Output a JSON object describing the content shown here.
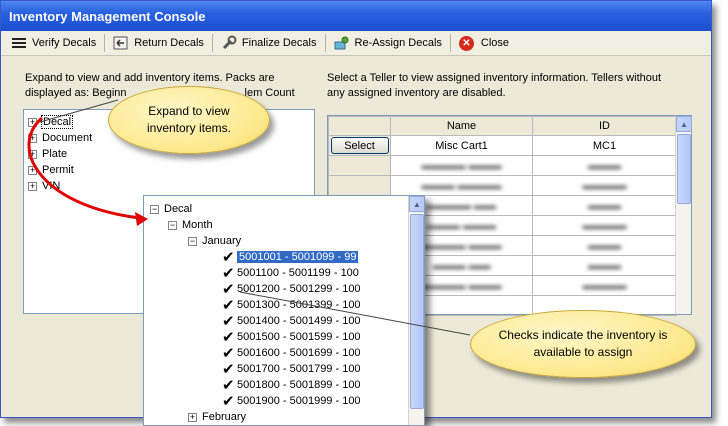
{
  "window": {
    "title": "Inventory Management Console"
  },
  "toolbar": {
    "verify_label": "Verify Decals",
    "return_label": "Return Decals",
    "finalize_label": "Finalize Decals",
    "reassign_label": "Re-Assign Decals",
    "close_label": "Close"
  },
  "left_panel": {
    "description_line1": "Expand to view and add inventory items.  Packs are",
    "description_line2_start": "displayed as:  Beginn",
    "description_line2_end": "lem Count",
    "tree": [
      {
        "label": "Decal"
      },
      {
        "label": "Document"
      },
      {
        "label": "Plate"
      },
      {
        "label": "Permit"
      },
      {
        "label": "VIN"
      }
    ]
  },
  "right_panel": {
    "description_line1": "Select a Teller to view assigned inventory information.  Tellers without",
    "description_line2": "any assigned inventory are disabled.",
    "columns": [
      "Name",
      "ID"
    ],
    "rows": [
      {
        "action": "Select",
        "name": "Misc Cart1",
        "id": "MC1"
      }
    ]
  },
  "zoom_tree": {
    "root": "Decal",
    "group": "Month",
    "month_open": "January",
    "ranges": [
      "5001001 - 5001099 - 99",
      "5001100 - 5001199 - 100",
      "5001200 - 5001299 - 100",
      "5001300 - 5001399 - 100",
      "5001400 - 5001499 - 100",
      "5001500 - 5001599 - 100",
      "5001600 - 5001699 - 100",
      "5001700 - 5001799 - 100",
      "5001800 - 5001899 - 100",
      "5001900 - 5001999 - 100"
    ],
    "month_closed": "February"
  },
  "callouts": {
    "expand_line1": "Expand to view",
    "expand_line2": "inventory items.",
    "checks_line1": "Checks indicate the inventory is",
    "checks_line2": "available to assign"
  },
  "colors": {
    "accent": "#316ac5",
    "callout": "#fde88a",
    "arrow": "#e00000"
  }
}
